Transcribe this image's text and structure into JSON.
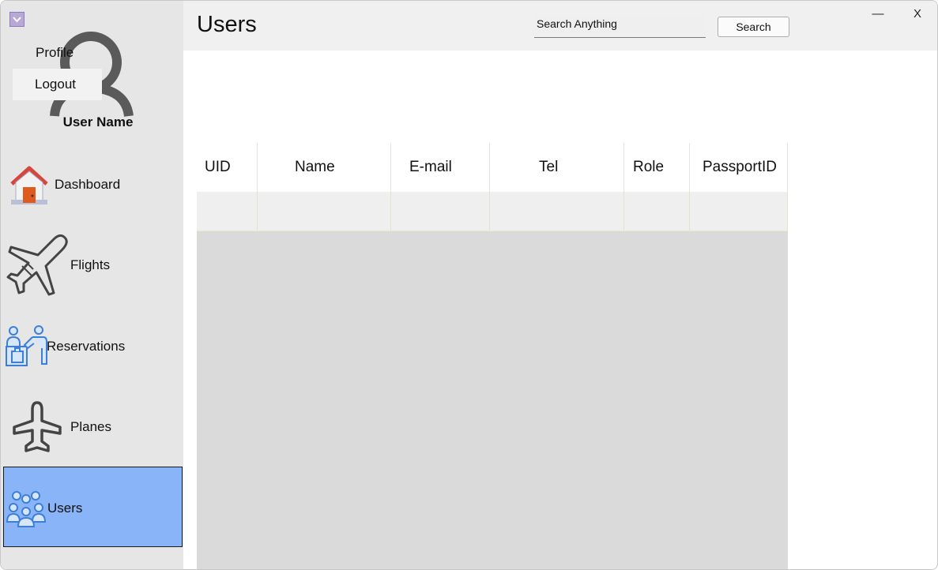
{
  "sidebar": {
    "menu_toggle_icon": "chevron-down-icon",
    "avatar_icon": "user-avatar-icon",
    "profile_menu": {
      "profile_label": "Profile",
      "logout_label": "Logout"
    },
    "user_name": "User Name",
    "items": [
      {
        "label": "Dashboard",
        "icon": "house-icon",
        "active": false
      },
      {
        "label": "Flights",
        "icon": "airplane-icon",
        "active": false
      },
      {
        "label": "Reservations",
        "icon": "reception-desk-icon",
        "active": false
      },
      {
        "label": "Planes",
        "icon": "plane-silhouette-icon",
        "active": false
      },
      {
        "label": "Users",
        "icon": "users-group-icon",
        "active": true
      }
    ],
    "active_color": "#8ab4f8"
  },
  "header": {
    "title": "Users",
    "search_value": "Search Anything",
    "search_button": "Search",
    "minimize_label": "—",
    "close_label": "X"
  },
  "table": {
    "columns": [
      "UID",
      "Name",
      "E-mail",
      "Tel",
      "Role",
      "PassportID"
    ],
    "rows": [
      [
        "",
        "",
        "",
        "",
        "",
        ""
      ]
    ]
  }
}
